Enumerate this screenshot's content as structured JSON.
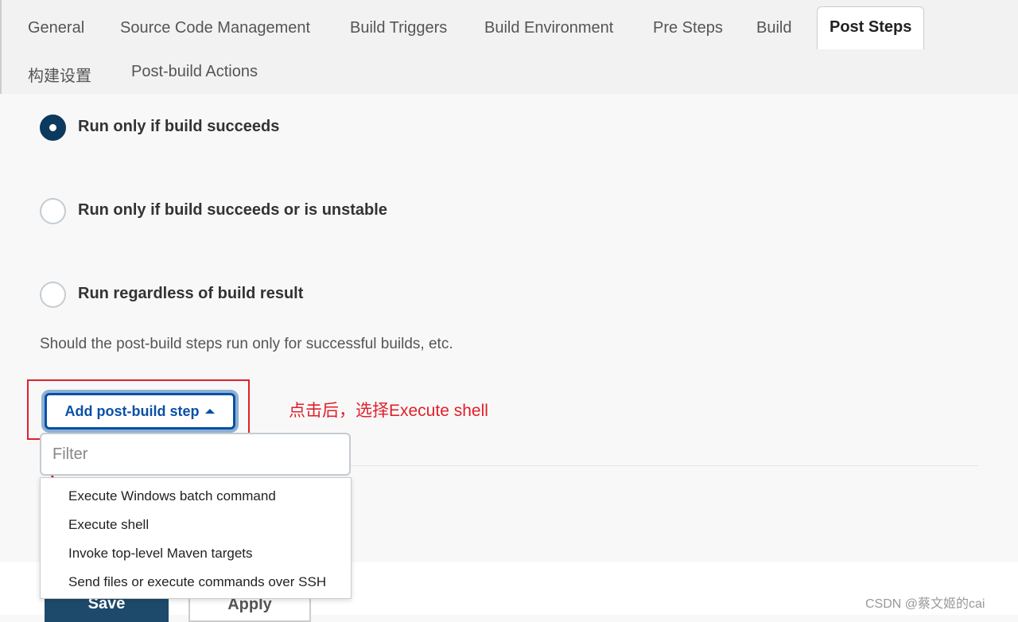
{
  "tabs": [
    {
      "label": "General",
      "active": false
    },
    {
      "label": "Source Code Management",
      "active": false
    },
    {
      "label": "Build Triggers",
      "active": false
    },
    {
      "label": "Build Environment",
      "active": false
    },
    {
      "label": "Pre Steps",
      "active": false
    },
    {
      "label": "Build",
      "active": false
    },
    {
      "label": "Post Steps",
      "active": true
    },
    {
      "label": "构建设置",
      "active": false
    },
    {
      "label": "Post-build Actions",
      "active": false
    }
  ],
  "radios": [
    {
      "label": "Run only if build succeeds",
      "checked": true
    },
    {
      "label": "Run only if build succeeds or is unstable",
      "checked": false
    },
    {
      "label": "Run regardless of build result",
      "checked": false
    }
  ],
  "help_text": "Should the post-build steps run only for successful builds, etc.",
  "add_button": {
    "label": "Add post-build step",
    "icon": "caret-up-icon"
  },
  "filter": {
    "placeholder": "Filter",
    "value": ""
  },
  "menu_items": [
    "Execute Windows batch command",
    "Execute shell",
    "Invoke top-level Maven targets",
    "Send files or execute commands over SSH"
  ],
  "annotation": "点击后，选择Execute shell",
  "footer": {
    "save": "Save",
    "apply": "Apply"
  },
  "watermark": "CSDN @蔡文姬的cai",
  "colors": {
    "accent": "#0a4fa8",
    "radio_checked": "#0b3a5e",
    "annotation": "#e0202a"
  }
}
